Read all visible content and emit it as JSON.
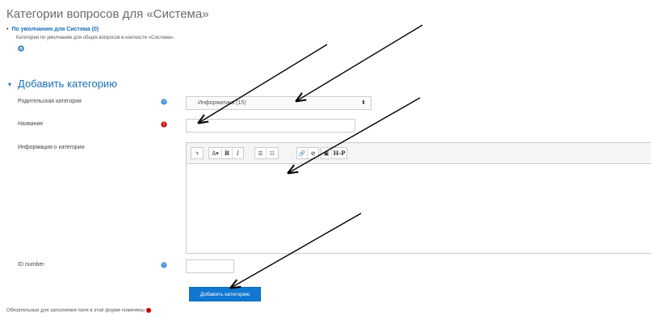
{
  "page": {
    "title": "Категории вопросов для «Система»"
  },
  "categories": {
    "items": [
      {
        "name": "По умолчанию для Система (0)",
        "description": "Категория по умолчанию для общих вопросов в контексте «Система»."
      }
    ]
  },
  "add_category": {
    "section_title": "Добавить категорию",
    "parent_label": "Родительская категория",
    "parent_value": "Информатика (15)",
    "name_label": "Название",
    "name_value": "",
    "info_label": "Информация о категории",
    "id_label": "ID number",
    "id_value": "",
    "submit_label": "Добавить категорию"
  },
  "editor": {
    "toolbar": [
      [
        "⤵"
      ],
      [
        "A▾",
        "B",
        "I"
      ],
      [
        "☰",
        "☷"
      ],
      [
        "🔗",
        "⊘"
      ],
      [
        "▣",
        "H-P"
      ]
    ]
  },
  "footer": {
    "required_note": "Обязательные для заполнения поля в этой форме помечены"
  },
  "colors": {
    "accent": "#1177d1",
    "link": "#1a6fb5",
    "required": "#cc0000",
    "help": "#3a8fd6"
  }
}
